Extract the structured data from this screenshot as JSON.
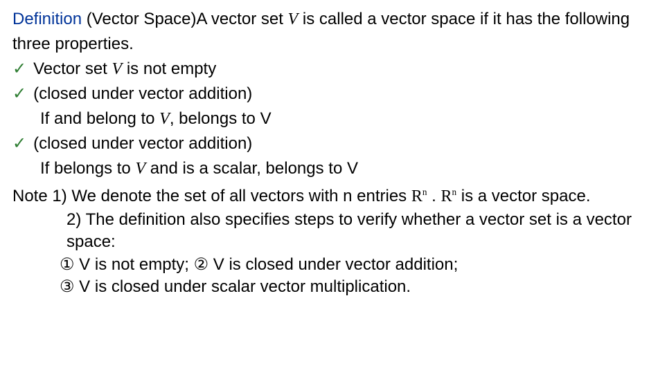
{
  "defLabel": "Definition",
  "defTitle": " (Vector Space)",
  "defBody1": "A vector set ",
  "V": "V",
  "defBody2": " is called a vector space if it has the following three properties.",
  "chk": "✓",
  "b1a": "Vector set ",
  "b1b": " is not empty",
  "b2": "(closed under vector addition)",
  "b2sa": "If  and  belong to ",
  "b2sb": ", belongs to V",
  "b3": "(closed under vector addition)",
  "b3sa": "If  belongs to ",
  "b3sb": " and  is a scalar, belongs to V",
  "n1a": "Note 1) We denote the set of all vectors with n entries ",
  "Rn": "R",
  "Rn_sup": "n",
  "n1b": " . ",
  "n1c": " is a vector space.",
  "n2a": "2) The definition also specifies steps to verify whether a vector set is a vector space:",
  "s1": "① V is not empty; ② V is closed under vector addition;",
  "s2": "③ V is closed under scalar vector multiplication."
}
